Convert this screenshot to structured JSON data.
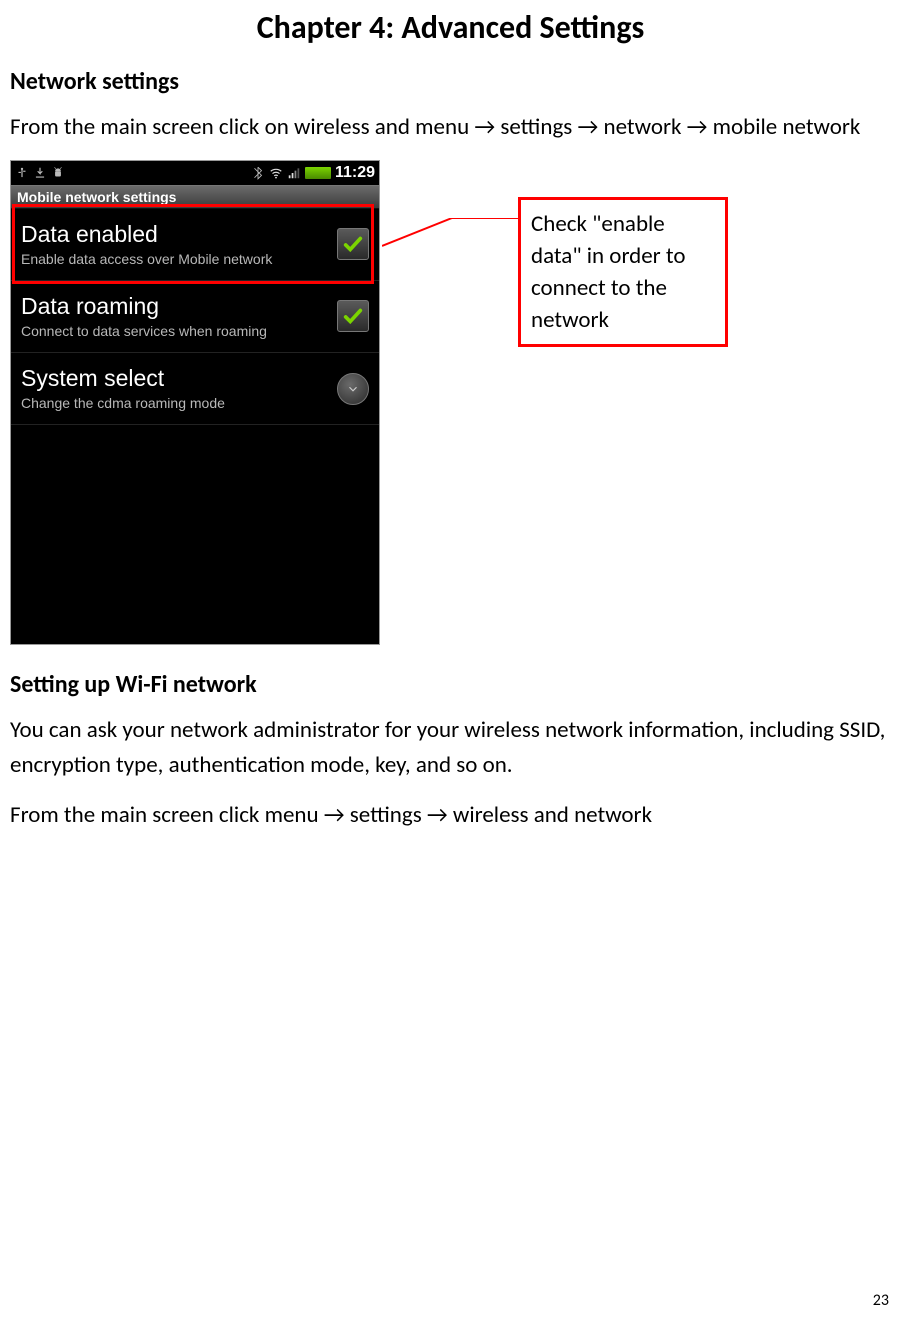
{
  "page_number": "23",
  "chapter_title": "Chapter 4: Advanced Settings",
  "section1_title": "Network settings",
  "section1_body_full": "From the main screen click on wireless and menu → settings → network → mobile network",
  "callout_text": "Check \"enable data\" in order to connect to the network",
  "phone": {
    "clock": "11:29",
    "screen_title": "Mobile network settings",
    "rows": [
      {
        "title": "Data enabled",
        "sub": "Enable data access over Mobile network",
        "type": "check",
        "checked": true
      },
      {
        "title": "Data roaming",
        "sub": "Connect to data services when roaming",
        "type": "check",
        "checked": true
      },
      {
        "title": "System select",
        "sub": "Change the cdma roaming mode",
        "type": "disclose"
      }
    ]
  },
  "section2_title": "Setting up Wi-Fi network",
  "section2_body1": "You can ask your network administrator for your wireless network information, including SSID, encryption type, authentication mode, key, and so on.",
  "section2_body2_full": "From the main screen click menu → settings → wireless and network"
}
